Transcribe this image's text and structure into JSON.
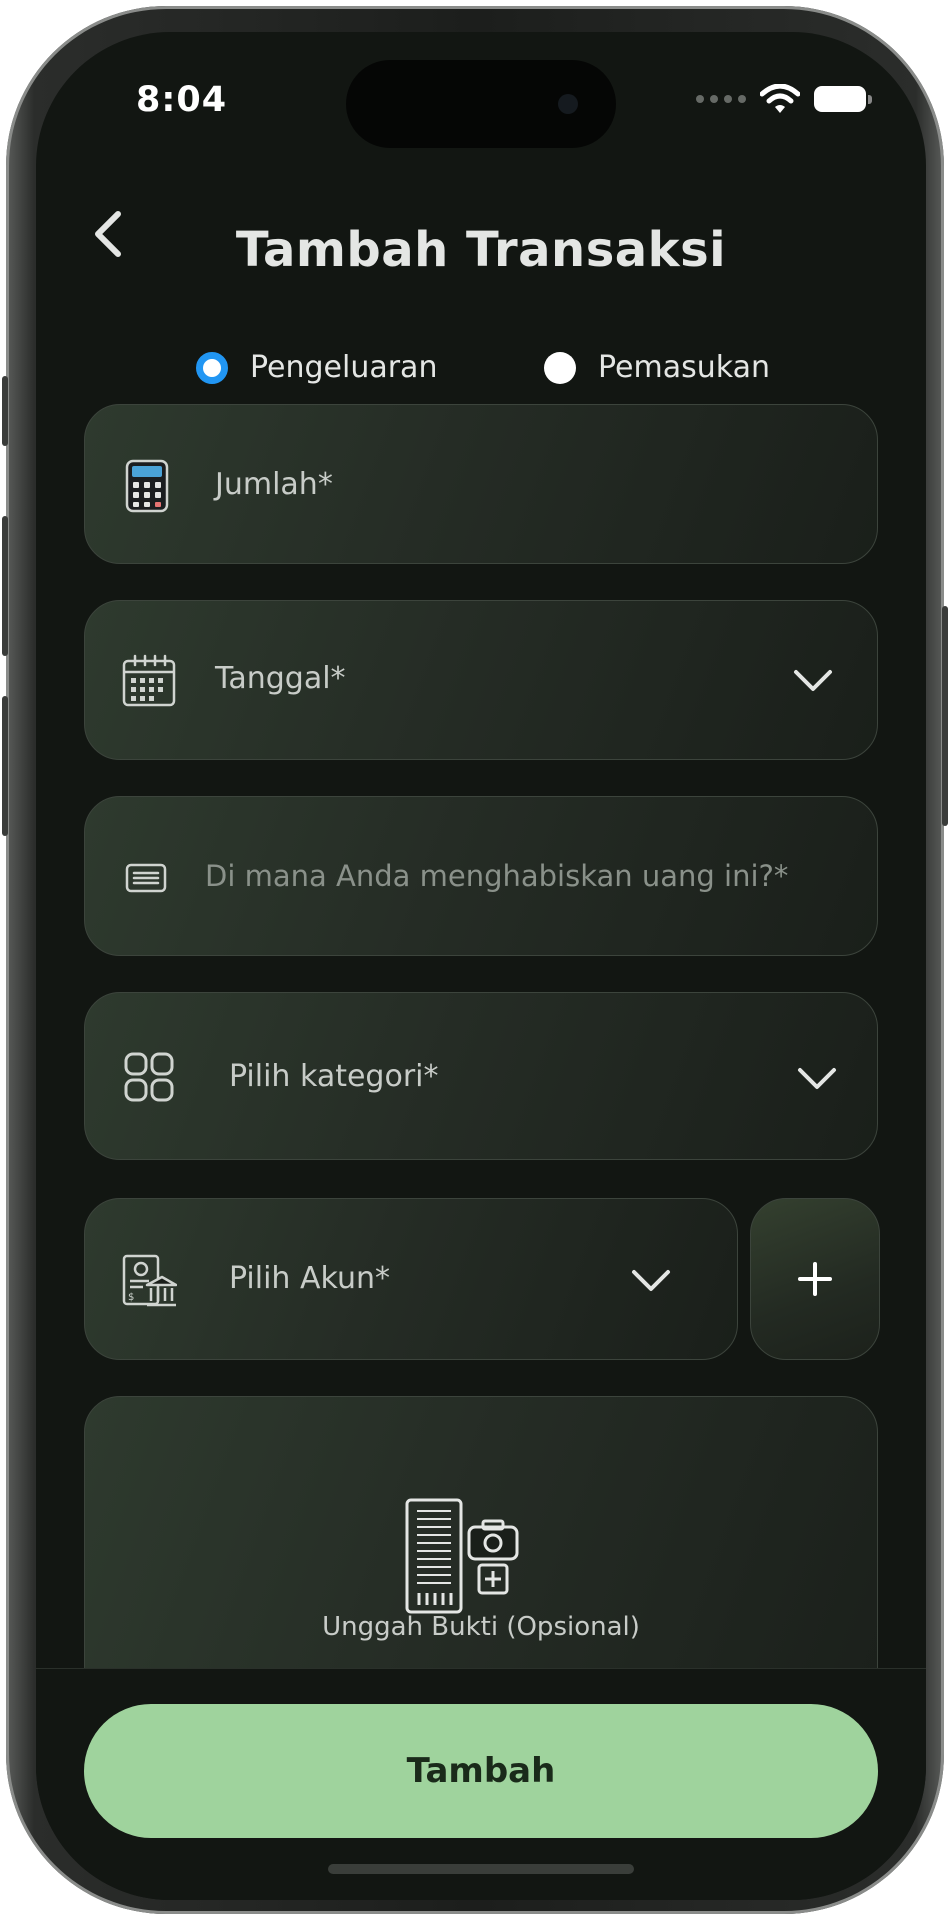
{
  "status_bar": {
    "time": "8:04"
  },
  "header": {
    "title": "Tambah Transaksi"
  },
  "type_options": [
    {
      "label": "Pengeluaran",
      "selected": true
    },
    {
      "label": "Pemasukan",
      "selected": false
    }
  ],
  "form": {
    "amount_label": "Jumlah*",
    "date_label": "Tanggal*",
    "description_placeholder": "Di mana Anda menghabiskan uang ini?*",
    "category_label": "Pilih kategori*",
    "account_label": "Pilih Akun*",
    "add_account_symbol": "+",
    "upload_label": "Unggah Bukti (Opsional)"
  },
  "submit": {
    "label": "Tambah"
  },
  "colors": {
    "background": "#121612",
    "accent_radio": "#2196f3",
    "submit_button": "#9fd39d"
  },
  "icons": {
    "amount": "calculator-icon",
    "date": "calendar-icon",
    "description": "notes-icon",
    "category": "grid-icon",
    "account": "bank-account-icon",
    "upload": "receipt-camera-icon"
  }
}
